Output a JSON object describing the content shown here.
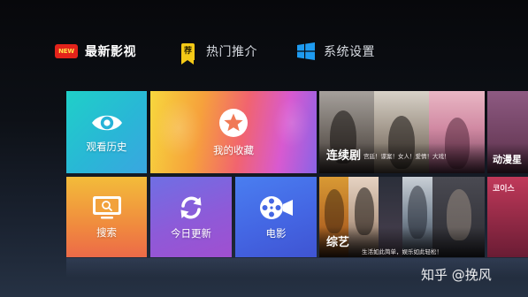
{
  "nav": {
    "items": [
      {
        "label": "最新影视",
        "icon": "new-badge-icon",
        "badge_text": "NEW",
        "active": true
      },
      {
        "label": "热门推介",
        "icon": "recommend-tag-icon",
        "badge_text": "荐",
        "active": false
      },
      {
        "label": "系统设置",
        "icon": "windows-logo-icon",
        "active": false
      }
    ]
  },
  "tiles": {
    "history": {
      "label": "观看历史",
      "icon": "eye-icon"
    },
    "favorites": {
      "label": "我的收藏",
      "icon": "star-icon"
    },
    "search": {
      "label": "搜索",
      "icon": "tv-search-icon"
    },
    "update": {
      "label": "今日更新",
      "icon": "refresh-icon"
    },
    "movie": {
      "label": "电影",
      "icon": "film-reel-icon"
    }
  },
  "posters": {
    "series": {
      "title": "连续剧",
      "desc": "宫廷！谍案！女人！爱情！大戏！"
    },
    "variety": {
      "title": "综艺",
      "desc": "生活如此简单，娱乐如此轻松！"
    },
    "anime": {
      "title": "动漫星"
    },
    "anime2": {
      "badge": "코이스"
    }
  },
  "watermark": "知乎 @挽风",
  "colors": {
    "history_tile": "#29b7d6",
    "search_tile": "#f08b3e",
    "update_tile": "#8e5ad8",
    "movie_tile": "#4466e3",
    "new_badge": "#e3231b",
    "recommend_badge": "#f4c917",
    "windows_logo": "#1e9bf0"
  }
}
